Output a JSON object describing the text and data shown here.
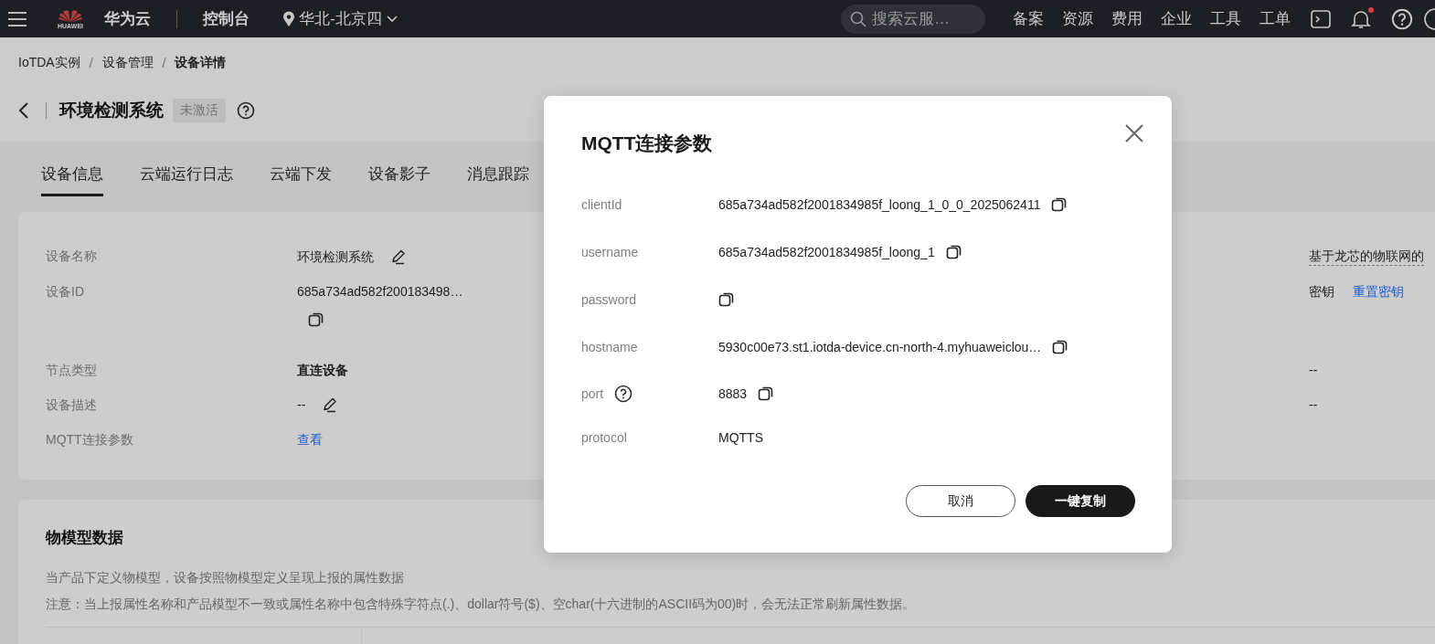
{
  "top_bar": {
    "brand_caption": "HUAWEI",
    "brand": "华为云",
    "console": "控制台",
    "region": "华北-北京四",
    "search": {
      "placeholder": "搜索云服…"
    },
    "nav": [
      "备案",
      "资源",
      "费用",
      "企业",
      "工具",
      "工单"
    ],
    "notification_dot": true
  },
  "breadcrumb": [
    {
      "label": "IoTDA实例",
      "kind": "link"
    },
    {
      "label": "/",
      "kind": "separator"
    },
    {
      "label": "设备管理",
      "kind": "link"
    },
    {
      "label": "/",
      "kind": "separator"
    },
    {
      "label": "设备详情",
      "kind": "current"
    }
  ],
  "title": {
    "text": "环境检测系统",
    "status": "未激活"
  },
  "tabs": [
    {
      "label": "设备信息",
      "selected": true
    },
    {
      "label": "云端运行日志",
      "selected": false
    },
    {
      "label": "云端下发",
      "selected": false
    },
    {
      "label": "设备影子",
      "selected": false
    },
    {
      "label": "消息跟踪",
      "selected": false
    }
  ],
  "device_info": {
    "fields": [
      {
        "label": "设备名称",
        "value": "环境检测系统",
        "kind": "editable"
      },
      {
        "label": "设备ID",
        "value": "685a734ad582f200183498…",
        "kind": "copyable"
      },
      {
        "label": "节点类型",
        "value": "直连设备",
        "kind": "strong"
      },
      {
        "label": "设备描述",
        "value": "--",
        "kind": "editable"
      },
      {
        "label": "MQTT连接参数",
        "value": "查看",
        "kind": "link"
      }
    ],
    "column_2": [
      {
        "text": "基于龙芯的物联网的",
        "kind": "dashed"
      },
      {
        "text": "密钥",
        "link": "重置密钥",
        "kind": "plain"
      },
      {
        "text": "--",
        "kind": "plain"
      },
      {
        "text": "--",
        "kind": "plain"
      }
    ]
  },
  "model_section": {
    "title": "物模型数据",
    "lines": [
      "当产品下定义物模型，设备按照物模型定义呈现上报的属性数据",
      "注意：当上报属性名称和产品模型不一致或属性名称中包含特殊字符点(.)、dollar符号($)、空char(十六进制的ASCII码为00)时，会无法正常刷新属性数据。"
    ]
  },
  "dialog": {
    "title": "MQTT连接参数",
    "rows": [
      {
        "label": "clientId",
        "value": "685a734ad582f2001834985f_loong_1_0_0_2025062411",
        "copyable": true,
        "help": false
      },
      {
        "label": "username",
        "value": "685a734ad582f2001834985f_loong_1",
        "copyable": true,
        "help": false
      },
      {
        "label": "password",
        "copyable": true,
        "help": false
      },
      {
        "label": "hostname",
        "value": "5930c00e73.st1.iotda-device.cn-north-4.myhuaweiclou…",
        "copyable": true,
        "help": false
      },
      {
        "label": "port",
        "value": "8883",
        "copyable": true,
        "help": true
      },
      {
        "label": "protocol",
        "value": "MQTTS",
        "copyable": false,
        "help": false
      }
    ],
    "buttons": [
      {
        "label": "取消",
        "kind": "secondary"
      },
      {
        "label": "一键复制",
        "kind": "primary"
      }
    ]
  }
}
